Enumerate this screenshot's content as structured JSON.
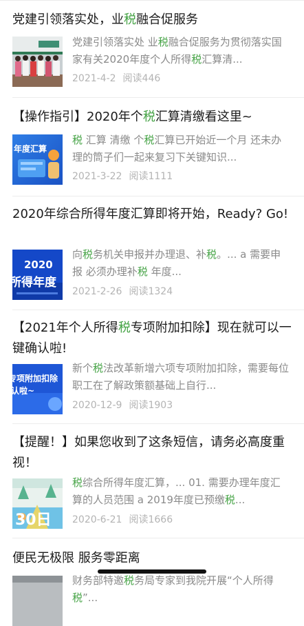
{
  "colors": {
    "highlight": "#45a345",
    "title": "#1b1b1b",
    "summary": "#8a8a8a",
    "meta": "#b3b3b3"
  },
  "articles": [
    {
      "title": [
        {
          "t": "党建引领落实处，业"
        },
        {
          "t": "税",
          "h": true
        },
        {
          "t": "融合促服务"
        }
      ],
      "summary": [
        {
          "t": "党建引领落实处 业"
        },
        {
          "t": "税",
          "h": true
        },
        {
          "t": "融合促服务为贯彻落实国家有关2020年度个人所得"
        },
        {
          "t": "税",
          "h": true
        },
        {
          "t": "汇算清..."
        }
      ],
      "date": "2021-4-2",
      "reads": "阅读446",
      "thumb": {
        "type": "photo-group"
      }
    },
    {
      "title": [
        {
          "t": "【操作指引】2020年个"
        },
        {
          "t": "税",
          "h": true
        },
        {
          "t": "汇算清缴看这里~"
        }
      ],
      "summary": [
        {
          "t": "税",
          "h": true
        },
        {
          "t": " 汇算 清缴 个"
        },
        {
          "t": "税",
          "h": true
        },
        {
          "t": "汇算已开始近一个月 还未办理的筒子们一起来复习下关键知识..."
        }
      ],
      "date": "2021-3-22",
      "reads": "阅读1111",
      "thumb": {
        "type": "banner-blue",
        "caption": "年度汇算"
      }
    },
    {
      "title": [
        {
          "t": "2020年综合所得年度汇算即将开始，Ready? Go!"
        }
      ],
      "summary": [
        {
          "t": "向"
        },
        {
          "t": "税",
          "h": true
        },
        {
          "t": "务机关申报并办理退、补"
        },
        {
          "t": "税",
          "h": true
        },
        {
          "t": "。... a 需要申报 必须办理补"
        },
        {
          "t": "税",
          "h": true
        },
        {
          "t": " 年度..."
        }
      ],
      "date": "2021-2-26",
      "reads": "阅读1324",
      "thumb": {
        "type": "banner-2020",
        "caption1": "2020",
        "caption2": "所得年度"
      }
    },
    {
      "title": [
        {
          "t": "【2021年个人所得"
        },
        {
          "t": "税",
          "h": true
        },
        {
          "t": "专项附加扣除】现在就可以一键确认啦!"
        }
      ],
      "summary": [
        {
          "t": "新个"
        },
        {
          "t": "税",
          "h": true
        },
        {
          "t": "法改革新增六项专项附加扣除，需要每位职工在了解政策额基础上自行..."
        }
      ],
      "date": "2020-12-9",
      "reads": "阅读1903",
      "thumb": {
        "type": "banner-deduct",
        "caption1": "专项附加扣除",
        "caption2": "认啦~"
      }
    },
    {
      "title": [
        {
          "t": "【提醒！】如果您收到了这条短信，请务必高度重视！"
        }
      ],
      "summary": [
        {
          "t": "税",
          "h": true
        },
        {
          "t": "综合所得年度汇算，... 01. 需要办理年度汇算的人员范围 a 2019年度已预缴"
        },
        {
          "t": "税",
          "h": true
        },
        {
          "t": "..."
        }
      ],
      "date": "2020-6-21",
      "reads": "阅读1666",
      "thumb": {
        "type": "poster-30",
        "caption": "30日"
      }
    },
    {
      "title": [
        {
          "t": "便民无极限 服务零距离"
        }
      ],
      "summary": [
        {
          "t": "财务部特邀"
        },
        {
          "t": "税",
          "h": true
        },
        {
          "t": "务局专家到我院开展“个人所得"
        },
        {
          "t": "税",
          "h": true
        },
        {
          "t": "”..."
        }
      ],
      "date": "",
      "reads": "",
      "thumb": {
        "type": "photo-grey"
      }
    }
  ]
}
